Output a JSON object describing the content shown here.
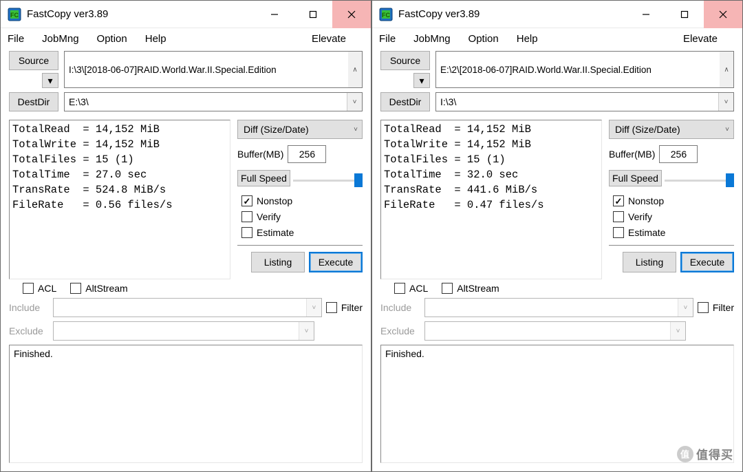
{
  "title": "FastCopy ver3.89",
  "menu": {
    "file": "File",
    "jobmng": "JobMng",
    "option": "Option",
    "help": "Help",
    "elevate": "Elevate"
  },
  "labels": {
    "source": "Source",
    "destdir": "DestDir",
    "diff": "Diff (Size/Date)",
    "buffer_lab": "Buffer(MB)",
    "speed": "Full Speed",
    "nonstop": "Nonstop",
    "verify": "Verify",
    "estimate": "Estimate",
    "listing": "Listing",
    "execute": "Execute",
    "acl": "ACL",
    "altstream": "AltStream",
    "include": "Include",
    "exclude": "Exclude",
    "filter": "Filter",
    "log": "Finished."
  },
  "checks": {
    "nonstop": true,
    "verify": false,
    "estimate": false,
    "acl": false,
    "altstream": false,
    "filter": false
  },
  "buffer": "256",
  "windows": [
    {
      "source": "I:\\3\\[2018-06-07]RAID.World.War.II.Special.Edition",
      "destdir": "E:\\3\\",
      "stats": "TotalRead  = 14,152 MiB\nTotalWrite = 14,152 MiB\nTotalFiles = 15 (1)\nTotalTime  = 27.0 sec\nTransRate  = 524.8 MiB/s\nFileRate   = 0.56 files/s"
    },
    {
      "source": "E:\\2\\[2018-06-07]RAID.World.War.II.Special.Edition",
      "destdir": "I:\\3\\",
      "stats": "TotalRead  = 14,152 MiB\nTotalWrite = 14,152 MiB\nTotalFiles = 15 (1)\nTotalTime  = 32.0 sec\nTransRate  = 441.6 MiB/s\nFileRate   = 0.47 files/s"
    }
  ],
  "watermark": "值得买"
}
